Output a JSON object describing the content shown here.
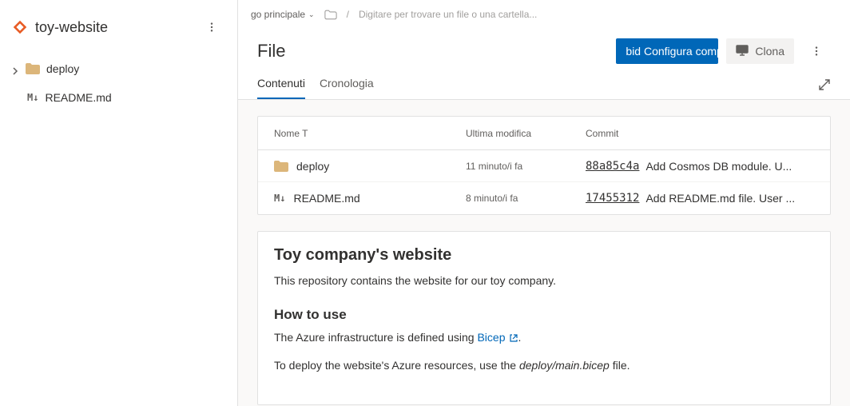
{
  "sidebar": {
    "repo_name": "toy-website",
    "tree": [
      {
        "name": "deploy",
        "type": "folder"
      },
      {
        "name": "README.md",
        "type": "md"
      }
    ]
  },
  "breadcrumb": {
    "branch_label": "go principale",
    "search_placeholder": "Digitare per trovare un file o una cartella...",
    "separator": "/"
  },
  "header": {
    "title": "File",
    "build_button": "bid Configura compil",
    "clone_button": "Clona"
  },
  "tabs": {
    "items": [
      "Contenuti",
      "Cronologia"
    ],
    "active": 0
  },
  "file_table": {
    "columns": {
      "name": "Nome T",
      "modified": "Ultima modifica",
      "commit": "Commit"
    },
    "rows": [
      {
        "name": "deploy",
        "type": "folder",
        "modified": "11 minuto/i fa",
        "hash": "88a85c4a",
        "msg": "Add Cosmos DB module. U..."
      },
      {
        "name": "README.md",
        "type": "md",
        "modified": "8 minuto/i fa",
        "hash": "17455312",
        "msg": "Add README.md file. User ..."
      }
    ]
  },
  "readme": {
    "h2": "Toy company's website",
    "p1": "This repository contains the website for our toy company.",
    "h3": "How to use",
    "p2_pre": "The Azure infrastructure is defined using ",
    "p2_link": "Bicep",
    "p2_post": ".",
    "p3_pre": "To deploy the website's Azure resources, use the ",
    "p3_em": "deploy/main.bicep",
    "p3_post": " file."
  }
}
